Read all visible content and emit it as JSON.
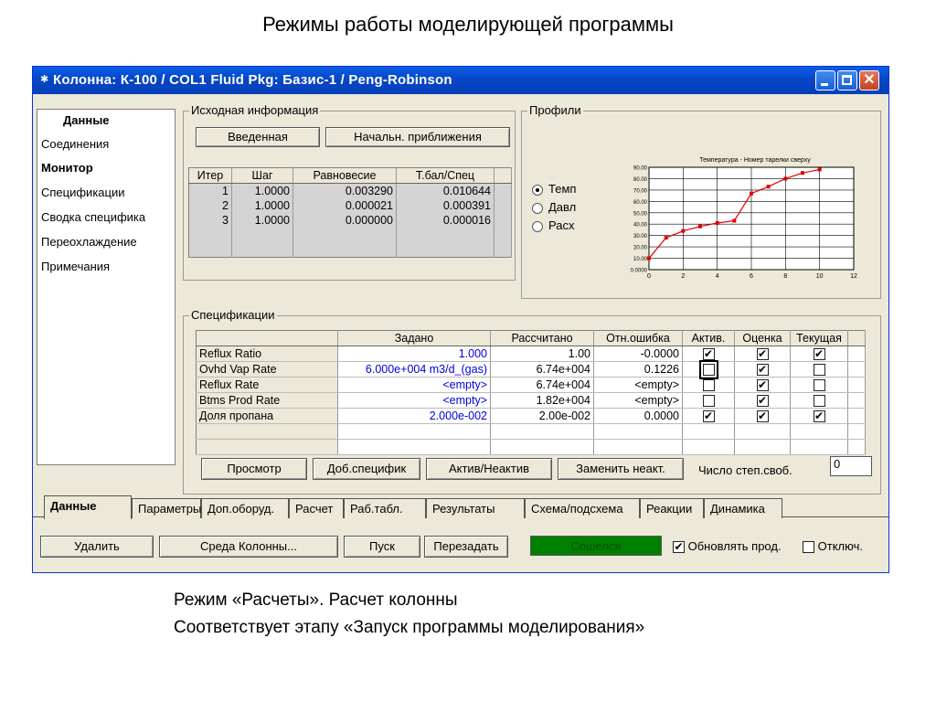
{
  "slide": {
    "title": "Режимы работы моделирующей программы",
    "caption1": "Режим «Расчеты». Расчет колонны",
    "caption2": "Соответствует этапу «Запуск программы моделирования»"
  },
  "window": {
    "title": "Колонна: К-100 / COL1  Fluid Pkg: Базис-1 / Peng-Robinson",
    "icon": "column-icon"
  },
  "nav": {
    "header": "Данные",
    "items": [
      "Соединения",
      "Монитор",
      "Спецификации",
      "Сводка специфика",
      "Переохлаждение",
      "Примечания"
    ]
  },
  "initial": {
    "legend": "Исходная информация",
    "btn_entered": "Введенная",
    "btn_initial": "Начальн. приближения"
  },
  "iterations": {
    "headers": [
      "Итер",
      "Шаг",
      "Равновесие",
      "Т.бал/Спец"
    ],
    "rows": [
      [
        "1",
        "1.0000",
        "0.003290",
        "0.010644"
      ],
      [
        "2",
        "1.0000",
        "0.000021",
        "0.000391"
      ],
      [
        "3",
        "1.0000",
        "0.000000",
        "0.000016"
      ]
    ]
  },
  "profiles": {
    "legend": "Профили",
    "options": [
      "Темп",
      "Давл",
      "Расх"
    ],
    "selected": "Темп",
    "chart_data": {
      "type": "line",
      "title": "Температура - Номер тарелки сверху",
      "x": [
        0,
        1,
        2,
        3,
        4,
        5,
        6,
        7,
        8,
        9,
        10
      ],
      "values": [
        10,
        28,
        34,
        38,
        41,
        43,
        67,
        73,
        80,
        85,
        88
      ],
      "xlim": [
        0,
        12
      ],
      "ylim": [
        0,
        90
      ],
      "xticks": [
        "0",
        "2",
        "4",
        "6",
        "8",
        "10",
        "12"
      ],
      "yticks": [
        "0.0000",
        "10.00",
        "20.00",
        "30.00",
        "40.00",
        "50.00",
        "60.00",
        "70.00",
        "80.00",
        "90.00"
      ],
      "color": "#e00000",
      "grid": true
    }
  },
  "specs": {
    "legend": "Спецификации",
    "headers": [
      "",
      "Задано",
      "Рассчитано",
      "Отн.ошибка",
      "Актив.",
      "Оценка",
      "Текущая"
    ],
    "rows": [
      {
        "name": "Reflux Ratio",
        "spec": "1.000",
        "calc": "1.00",
        "err": "-0.0000",
        "active": true,
        "estimate": true,
        "current": true
      },
      {
        "name": "Ovhd Vap Rate",
        "spec": "6.000e+004 m3/d_(gas)",
        "calc": "6.74e+004",
        "err": "0.1226",
        "active": false,
        "estimate": true,
        "current": false
      },
      {
        "name": "Reflux Rate",
        "spec": "<empty>",
        "calc": "6.74e+004",
        "err": "<empty>",
        "active": false,
        "estimate": true,
        "current": false
      },
      {
        "name": "Btms Prod Rate",
        "spec": "<empty>",
        "calc": "1.82e+004",
        "err": "<empty>",
        "active": false,
        "estimate": true,
        "current": false
      },
      {
        "name": "Доля пропана",
        "spec": "2.000e-002",
        "calc": "2.00e-002",
        "err": "0.0000",
        "active": true,
        "estimate": true,
        "current": true
      }
    ],
    "btn_view": "Просмотр",
    "btn_add": "Доб.специфик",
    "btn_toggle": "Актив/Неактив",
    "btn_replace": "Заменить неакт.",
    "dof_label": "Число степ.своб.",
    "dof_value": "0"
  },
  "tabs": [
    "Данные",
    "Параметры",
    "Доп.оборуд.",
    "Расчет",
    "Раб.табл.",
    "Результаты",
    "Схема/подсхема",
    "Реакции",
    "Динамика"
  ],
  "active_tab": "Данные",
  "footer": {
    "btn_delete": "Удалить",
    "btn_env": "Среда Колонны...",
    "btn_run": "Пуск",
    "btn_reset": "Перезадать",
    "status": "Сошелся",
    "status_color": "#008000",
    "update_label": "Обновлять прод.",
    "update_checked": true,
    "ignore_label": "Отключ.",
    "ignore_checked": false
  }
}
